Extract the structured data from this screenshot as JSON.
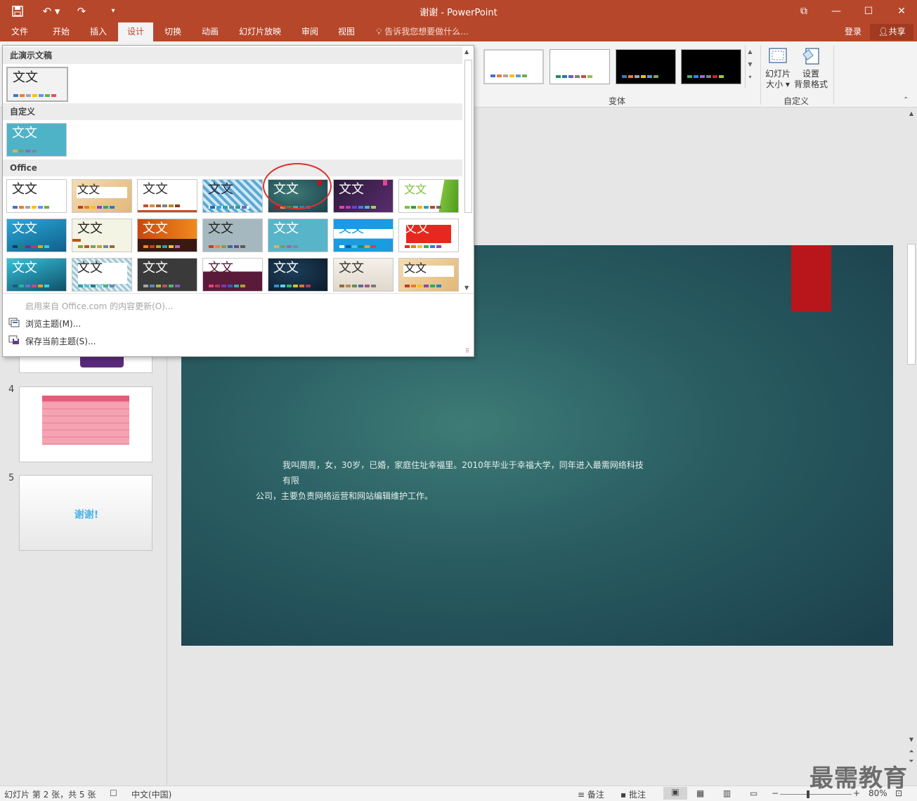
{
  "titlebar": {
    "title": "谢谢 - PowerPoint",
    "restore": "⧉",
    "minimize": "—",
    "maximize": "☐",
    "close": "✕"
  },
  "tabs": [
    {
      "label": "文件",
      "x": 0
    },
    {
      "label": "开始"
    },
    {
      "label": "插入"
    },
    {
      "label": "设计",
      "active": true
    },
    {
      "label": "切换"
    },
    {
      "label": "动画"
    },
    {
      "label": "幻灯片放映"
    },
    {
      "label": "审阅"
    },
    {
      "label": "视图"
    }
  ],
  "tellme": "告诉我您想要做什么...",
  "login": "登录",
  "share": "共享",
  "ribbon": {
    "variants_group": "变体",
    "custom_group": "自定义",
    "slide_size": [
      "幻灯片",
      "大小 ▾"
    ],
    "bg_format": [
      "设置",
      "背景格式"
    ]
  },
  "gallery": {
    "sec_this": "此演示文稿",
    "sec_custom": "自定义",
    "sec_office": "Office",
    "tile_text": "文文",
    "menu_enable": "启用来自 Office.com 的内容更新(O)...",
    "menu_browse": "浏览主题(M)...",
    "menu_save": "保存当前主题(S)..."
  },
  "thumbs": {
    "n4": "4",
    "n5": "5",
    "thanks": "谢谢!"
  },
  "slide": {
    "line1": "我叫周周，女，30岁，已婚，家庭住址幸福里。2010年毕业于幸福大学，同年进入最需网络科技有限",
    "line2": "公司，主要负责网络运营和网站编辑维护工作。"
  },
  "status": {
    "slide_info": "幻灯片 第 2 张，共 5 张",
    "lang": "中文(中国)",
    "notes": "备注",
    "comments": "批注",
    "zoom": "80%"
  },
  "watermark": "最需教育",
  "colors": {
    "accent": "#b7472a",
    "annotation": "#d9332f"
  }
}
